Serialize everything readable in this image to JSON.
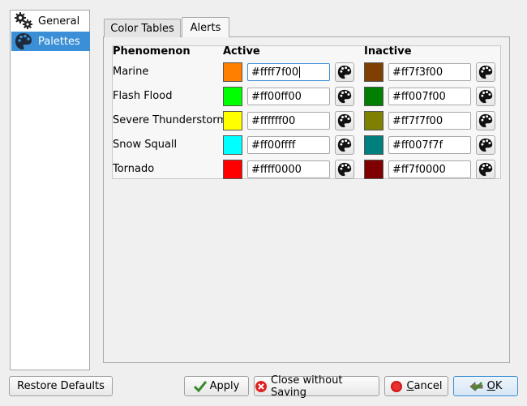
{
  "sidebar": {
    "items": [
      {
        "label": "General",
        "icon": "gears-icon"
      },
      {
        "label": "Palettes",
        "icon": "palette-icon"
      }
    ]
  },
  "tabs": [
    {
      "label": "Color Tables"
    },
    {
      "label": "Alerts"
    }
  ],
  "table": {
    "headers": {
      "phenomenon": "Phenomenon",
      "active": "Active",
      "inactive": "Inactive"
    },
    "rows": [
      {
        "name": "Marine",
        "active_hex": "#ffff7f00",
        "active_color": "#ff7f00",
        "inactive_hex": "#ff7f3f00",
        "inactive_color": "#7f3f00"
      },
      {
        "name": "Flash Flood",
        "active_hex": "#ff00ff00",
        "active_color": "#00ff00",
        "inactive_hex": "#ff007f00",
        "inactive_color": "#007f00"
      },
      {
        "name": "Severe Thunderstorm",
        "active_hex": "#ffffff00",
        "active_color": "#ffff00",
        "inactive_hex": "#ff7f7f00",
        "inactive_color": "#7f7f00"
      },
      {
        "name": "Snow Squall",
        "active_hex": "#ff00ffff",
        "active_color": "#00ffff",
        "inactive_hex": "#ff007f7f",
        "inactive_color": "#007f7f"
      },
      {
        "name": "Tornado",
        "active_hex": "#ffff0000",
        "active_color": "#ff0000",
        "inactive_hex": "#ff7f0000",
        "inactive_color": "#7f0000"
      }
    ]
  },
  "buttons": {
    "restore": "Restore Defaults",
    "apply": "Apply",
    "close": "Close without Saving",
    "cancel_pre": "",
    "cancel_u": "C",
    "cancel_post": "ancel",
    "ok_u": "O",
    "ok_post": "K"
  },
  "colors": {
    "accent": "#3b8fd6"
  }
}
